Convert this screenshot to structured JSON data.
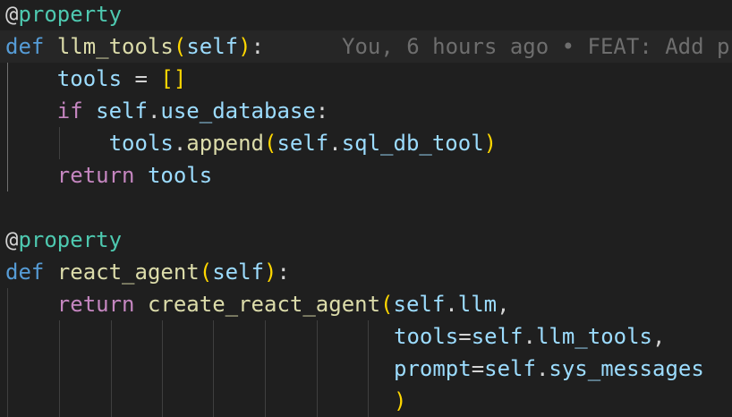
{
  "code": {
    "line1": {
      "at": "@",
      "deco": "property"
    },
    "line2": {
      "def": "def",
      "fn": "llm_tools",
      "lp": "(",
      "self": "self",
      "rp": ")",
      "colon": ":",
      "blame": "You, 6 hours ago • FEAT: Add p"
    },
    "line3": {
      "var": "tools",
      "eq": " = ",
      "lb": "[",
      "rb": "]"
    },
    "line4": {
      "kw": "if",
      "self": "self",
      "dot": ".",
      "attr": "use_database",
      "colon": ":"
    },
    "line5": {
      "var": "tools",
      "dot": ".",
      "fn": "append",
      "lp": "(",
      "self": "self",
      "dot2": ".",
      "attr": "sql_db_tool",
      "rp": ")"
    },
    "line6": {
      "kw": "return",
      "var": "tools"
    },
    "line7": {
      "at": "@",
      "deco": "property"
    },
    "line8": {
      "def": "def",
      "fn": "react_agent",
      "lp": "(",
      "self": "self",
      "rp": ")",
      "colon": ":"
    },
    "line9": {
      "kw": "return",
      "fn": "create_react_agent",
      "lp": "(",
      "self": "self",
      "dot": ".",
      "attr": "llm",
      "comma": ","
    },
    "line10": {
      "kw": "tools",
      "eq": "=",
      "self": "self",
      "dot": ".",
      "attr": "llm_tools",
      "comma": ","
    },
    "line11": {
      "kw": "prompt",
      "eq": "=",
      "self": "self",
      "dot": ".",
      "attr": "sys_messages"
    },
    "line12": {
      "rp": ")"
    }
  },
  "colors": {
    "background": "#1f1f1f",
    "keyword_def": "#569cd6",
    "keyword_control": "#c586c0",
    "function": "#dcdcaa",
    "variable": "#9cdcfe",
    "decorator": "#4ec9b0",
    "bracket": "#ffd700",
    "blame": "#6e6e6e"
  }
}
